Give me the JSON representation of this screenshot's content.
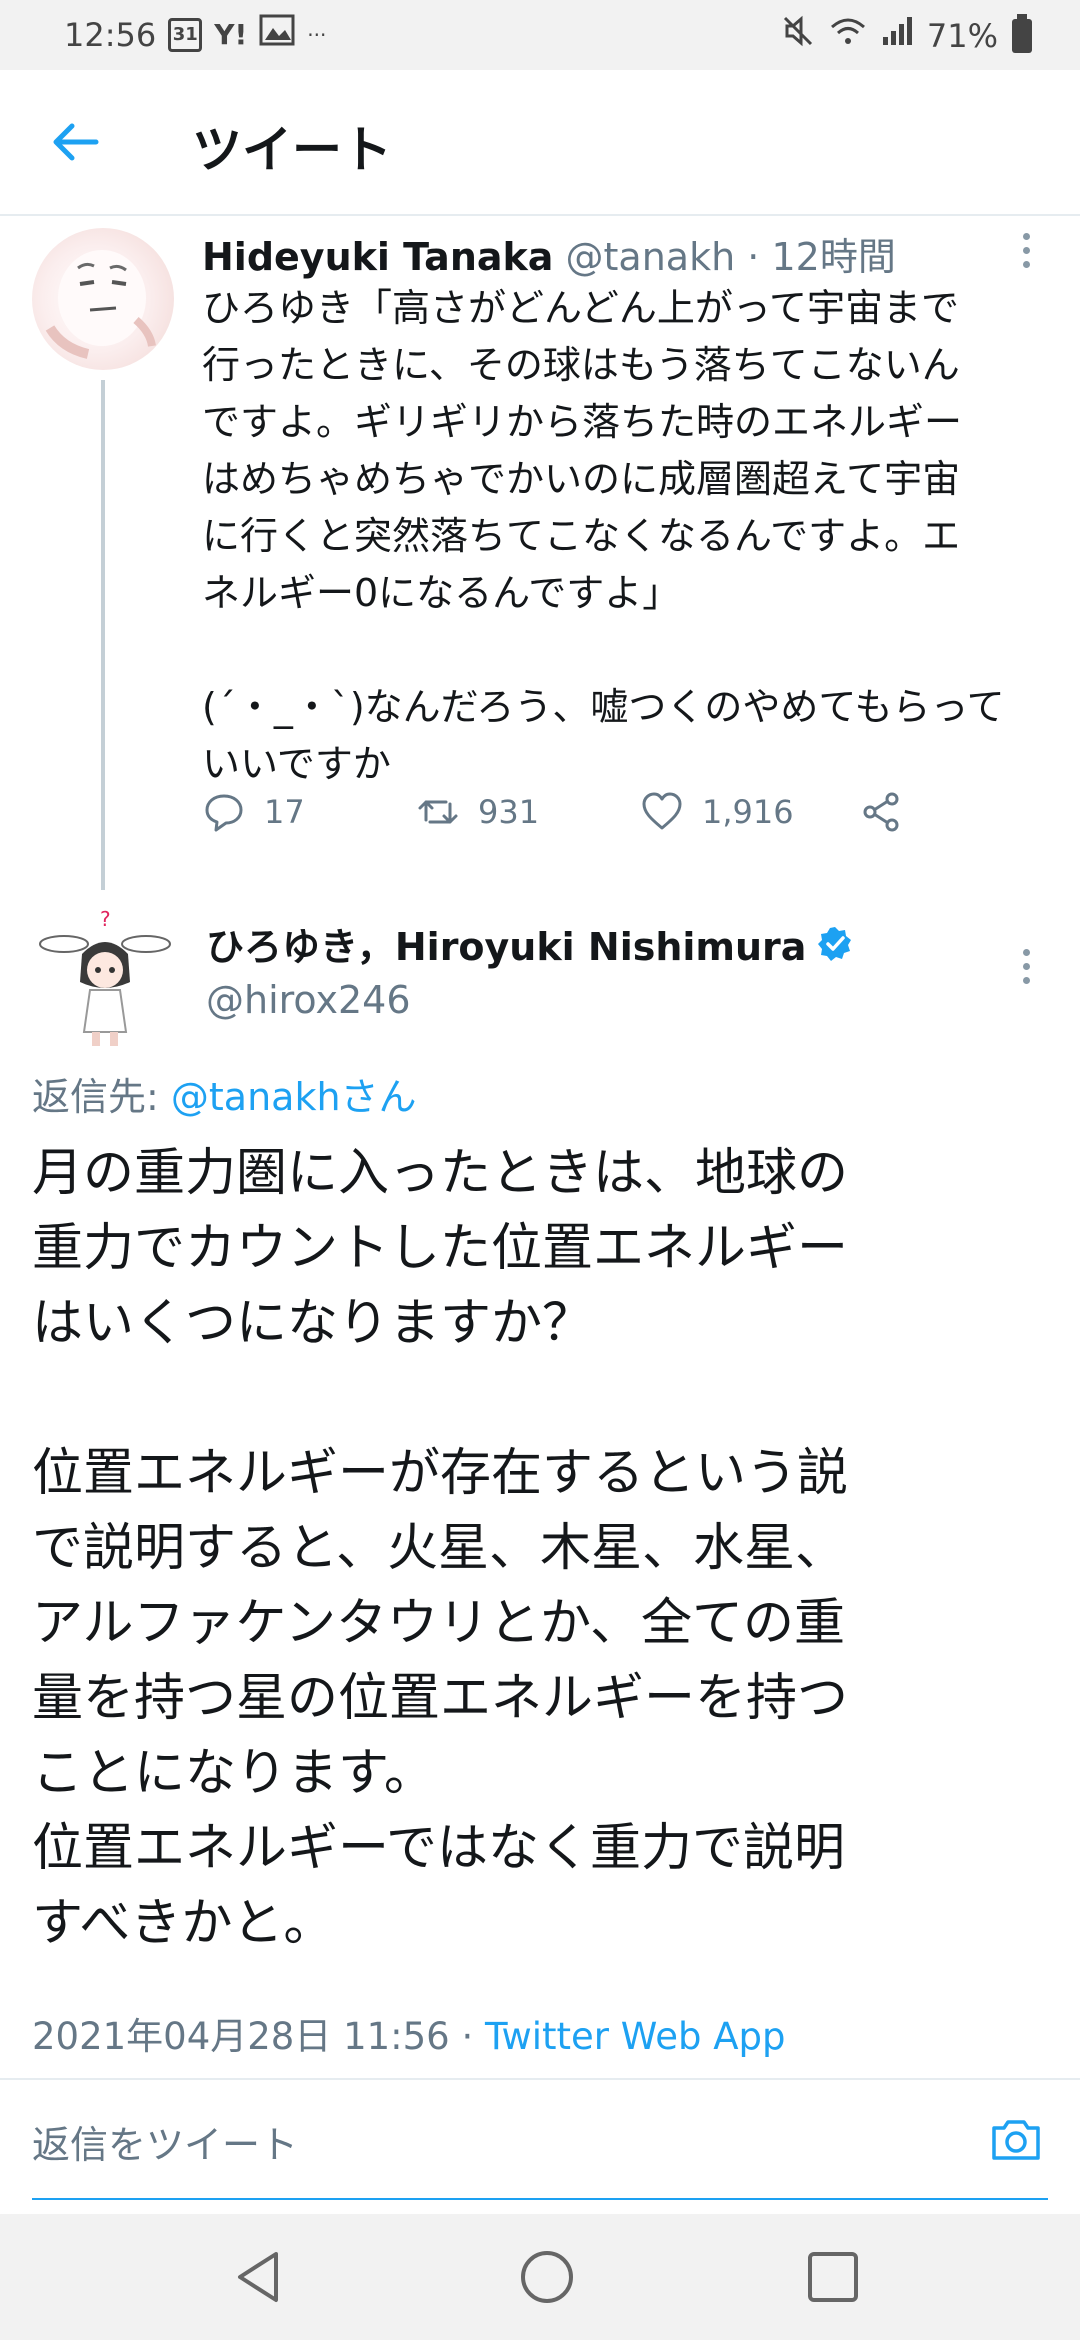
{
  "status_bar": {
    "time": "12:56",
    "calendar_day": "31",
    "yahoo": "Y!",
    "more": "···",
    "battery": "71%"
  },
  "header": {
    "title": "ツイート"
  },
  "parent_tweet": {
    "name": "Hideyuki Tanaka",
    "handle": "@tanakh",
    "separator": "·",
    "time": "12時間",
    "text": "ひろゆき「高さがどんどん上がって宇宙まで\n行ったときに、その球はもう落ちてこないん\nですよ。ギリギリから落ちた時のエネルギー\nはめちゃめちゃでかいのに成層圏超えて宇宙\nに行くと突然落ちてこなくなるんですよ。エ\nネルギー0になるんですよ」\n\n(´・_・`)なんだろう、嘘つくのやめてもらって\nいいですか",
    "replies": "17",
    "retweets": "931",
    "likes": "1,916"
  },
  "main_tweet": {
    "name": "ひろゆき，Hiroyuki Nishimura",
    "handle": "@hirox246",
    "reply_prefix": "返信先: ",
    "reply_target": "@tanakhさん",
    "text": "月の重力圏に入ったときは、地球の\n重力でカウントした位置エネルギー\nはいくつになりますか？\n\n位置エネルギーが存在するという説\nで説明すると、火星、木星、水星、\nアルファケンタウリとか、全ての重\n量を持つ星の位置エネルギーを持つ\nことになります。\n位置エネルギーではなく重力で説明\nすべきかと。",
    "timestamp": "2021年04月28日 11:56",
    "separator": " · ",
    "source": "Twitter Web App"
  },
  "reply_bar": {
    "placeholder": "返信をツイート"
  },
  "colors": {
    "accent": "#1da1f2",
    "muted": "#657786",
    "text": "#14171a"
  }
}
